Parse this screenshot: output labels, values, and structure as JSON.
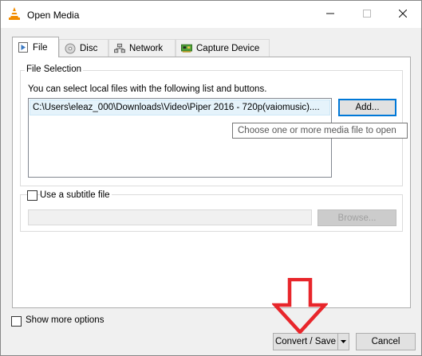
{
  "window": {
    "title": "Open Media",
    "app_icon": "vlc-cone-icon",
    "min_icon": "minimize-icon",
    "max_icon": "maximize-icon",
    "close_icon": "close-icon"
  },
  "tabs": [
    {
      "label": "File",
      "icon": "play-file-icon",
      "active": true
    },
    {
      "label": "Disc",
      "icon": "disc-icon",
      "active": false
    },
    {
      "label": "Network",
      "icon": "network-icon",
      "active": false
    },
    {
      "label": "Capture Device",
      "icon": "capture-card-icon",
      "active": false
    }
  ],
  "file_selection": {
    "group_label": "File Selection",
    "helper_text": "You can select local files with the following list and buttons.",
    "files": [
      "C:\\Users\\eleaz_000\\Downloads\\Video\\Piper 2016 - 720p(vaiomusic)...."
    ],
    "add_label": "Add...",
    "tooltip": "Choose one or more media file to open"
  },
  "subtitle": {
    "checkbox_label": "Use a subtitle file",
    "checked": false,
    "path_value": "",
    "browse_label": "Browse..."
  },
  "footer": {
    "show_more_label": "Show more options",
    "show_more_checked": false,
    "convert_label": "Convert / Save",
    "cancel_label": "Cancel"
  },
  "annotation": {
    "arrow_color": "#e8262b"
  },
  "colors": {
    "accent": "#0078d7",
    "vlc_orange": "#f28c00"
  }
}
